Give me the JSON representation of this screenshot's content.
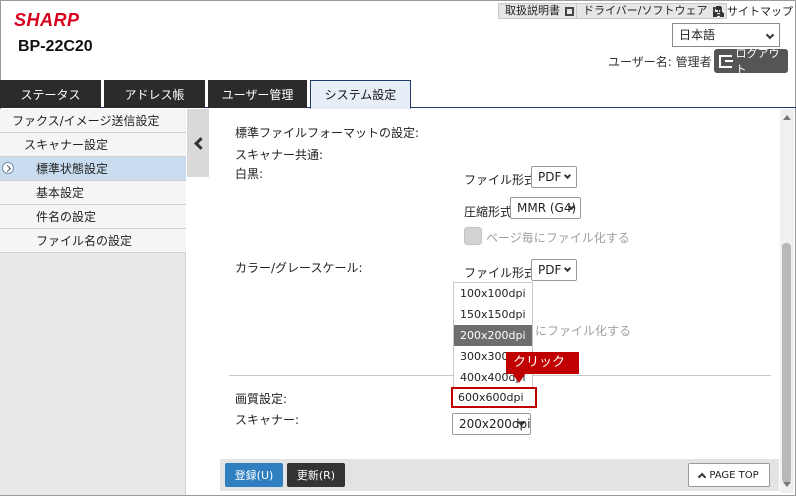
{
  "header": {
    "brand": "SHARP",
    "model": "BP-22C20",
    "links": {
      "manual": "取扱説明書",
      "driver": "ドライバー/ソフトウェア",
      "sitemap": "サイトマップ"
    },
    "language": "日本語",
    "user_label": "ユーザー名: 管理者",
    "logout": "ログアウト"
  },
  "tabs": [
    "ステータス",
    "アドレス帳",
    "ユーザー管理",
    "システム設定"
  ],
  "active_tab": "システム設定",
  "sidebar": {
    "items": [
      {
        "label": "ファクス/イメージ送信設定",
        "indent": 0
      },
      {
        "label": "スキャナー設定",
        "indent": 1
      },
      {
        "label": "標準状態設定",
        "indent": 2,
        "active": true
      },
      {
        "label": "基本設定",
        "indent": 2
      },
      {
        "label": "件名の設定",
        "indent": 2
      },
      {
        "label": "ファイル名の設定",
        "indent": 2
      }
    ]
  },
  "main": {
    "format_heading": "標準ファイルフォーマットの設定:",
    "scanner_common": "スキャナー共通:",
    "mono": {
      "label": "白黒:",
      "file_format_label": "ファイル形式:",
      "file_format_value": "PDF",
      "compression_label": "圧縮形式:",
      "compression_value": "MMR (G4)",
      "per_page_label": "ページ毎にファイル化する"
    },
    "color": {
      "label": "カラー/グレースケール:",
      "file_format_label": "ファイル形式:",
      "file_format_value": "PDF",
      "per_page_partial": "にファイル化する"
    },
    "resolution_options": [
      "100x100dpi",
      "150x150dpi",
      "200x200dpi",
      "300x300dpi",
      "400x400dpi",
      "600x600dpi"
    ],
    "highlighted_option": "200x200dpi",
    "quality_label": "画質設定:",
    "scanner_label": "スキャナー:",
    "scanner_value": "200x200dpi",
    "callout": "クリック"
  },
  "footer": {
    "register": "登録(U)",
    "update": "更新(R)",
    "page_top": "PAGE TOP"
  }
}
